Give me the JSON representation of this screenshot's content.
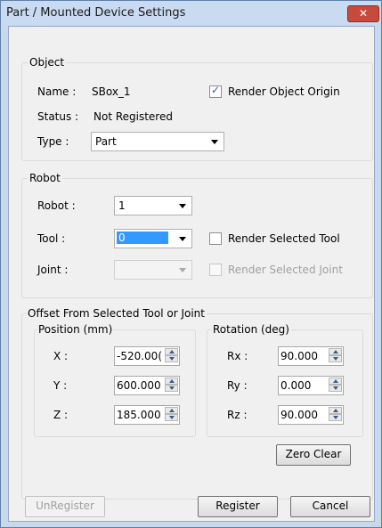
{
  "window": {
    "title": "Part / Mounted Device Settings",
    "close_symbol": "✕"
  },
  "object": {
    "group_label": "Object",
    "name_label": "Name :",
    "name_value": "SBox_1",
    "render_origin_label": "Render Object Origin",
    "render_origin_checked": true,
    "status_label": "Status :",
    "status_value": "Not Registered",
    "type_label": "Type :",
    "type_value": "Part"
  },
  "robot": {
    "group_label": "Robot",
    "robot_label": "Robot :",
    "robot_value": "1",
    "tool_label": "Tool :",
    "tool_value": "0",
    "render_tool_label": "Render Selected Tool",
    "render_tool_checked": false,
    "joint_label": "Joint :",
    "joint_value": "",
    "render_joint_label": "Render Selected Joint",
    "render_joint_checked": false
  },
  "offset": {
    "group_label": "Offset From Selected Tool or Joint",
    "position": {
      "label": "Position (mm)",
      "x_label": "X :",
      "x_value": "-520.00(",
      "y_label": "Y :",
      "y_value": "600.000",
      "z_label": "Z :",
      "z_value": "185.000"
    },
    "rotation": {
      "label": "Rotation (deg)",
      "rx_label": "Rx :",
      "rx_value": "90.000",
      "ry_label": "Ry :",
      "ry_value": "0.000",
      "rz_label": "Rz :",
      "rz_value": "90.000"
    },
    "zero_clear_label": "Zero Clear"
  },
  "buttons": {
    "unregister": "UnRegister",
    "register": "Register",
    "cancel": "Cancel"
  },
  "colors": {
    "title_bar": "#c9dbf0",
    "close_button": "#c74b3c",
    "selection": "#3399ff",
    "dialog_bg": "#f0f0f0"
  }
}
